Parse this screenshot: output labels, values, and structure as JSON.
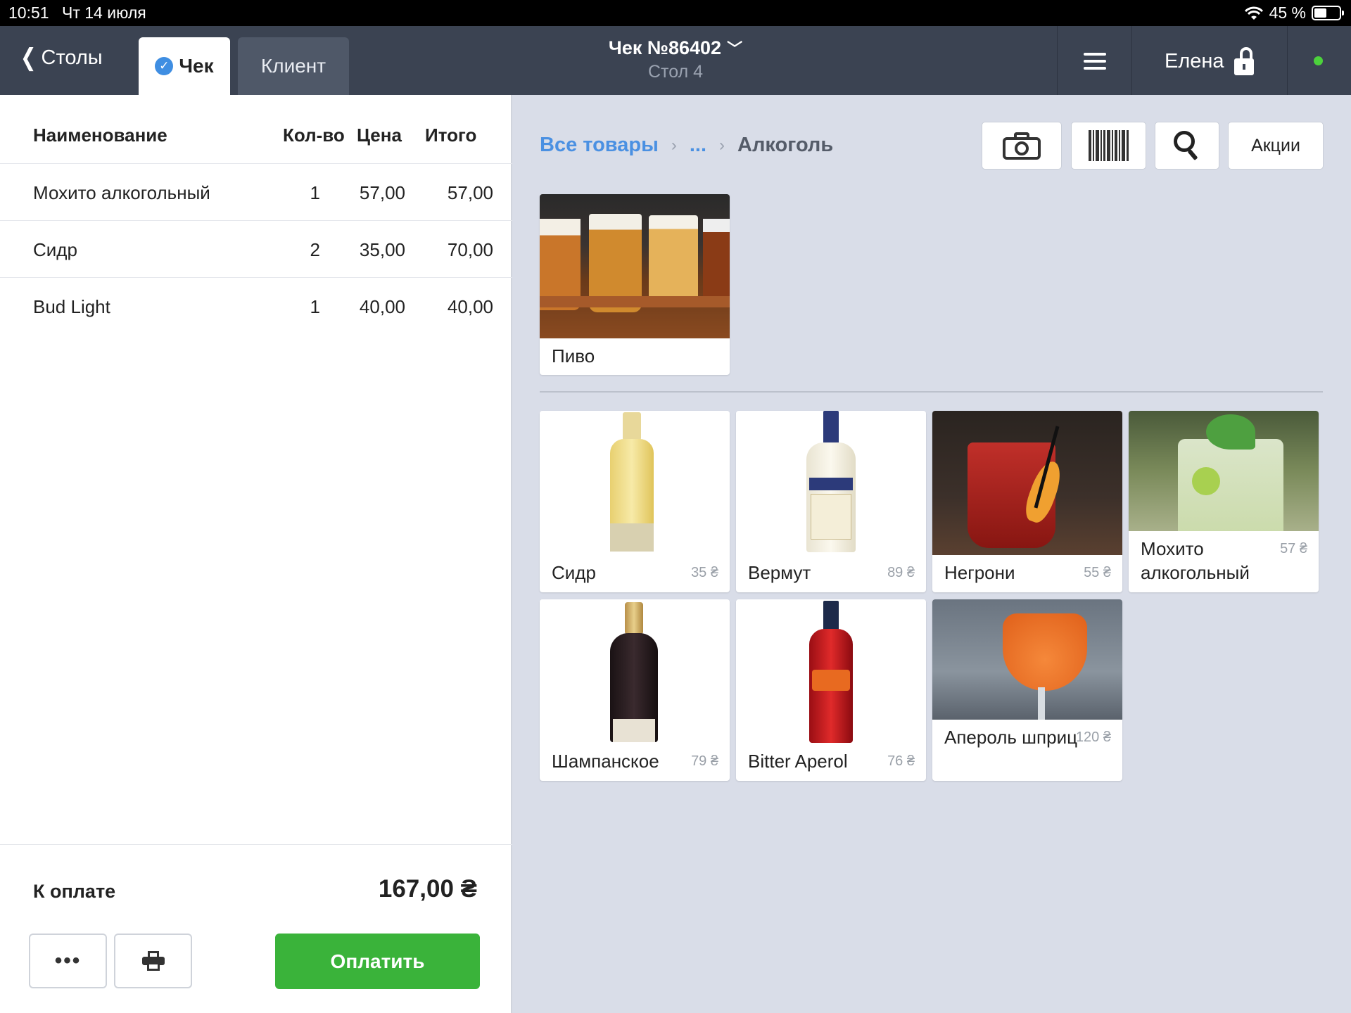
{
  "status": {
    "time": "10:51",
    "date": "Чт 14 июля",
    "battery": "45 %"
  },
  "header": {
    "back_label": "Столы",
    "tabs": [
      {
        "label": "Чек"
      },
      {
        "label": "Клиент"
      }
    ],
    "title": "Чек №86402",
    "subtitle": "Стол 4",
    "user": "Елена"
  },
  "check": {
    "columns": {
      "name": "Наименование",
      "qty": "Кол-во",
      "price": "Цена",
      "total": "Итого"
    },
    "rows": [
      {
        "name": "Мохито алкогольный",
        "qty": "1",
        "price": "57,00",
        "total": "57,00"
      },
      {
        "name": "Сидр",
        "qty": "2",
        "price": "35,00",
        "total": "70,00"
      },
      {
        "name": "Bud Light",
        "qty": "1",
        "price": "40,00",
        "total": "40,00"
      }
    ],
    "pay_label": "К оплате",
    "pay_total": "167,00 ₴",
    "more_label": "•••",
    "pay_button": "Оплатить"
  },
  "catalog": {
    "breadcrumb": {
      "root": "Все товары",
      "ellipsis": "...",
      "current": "Алкоголь"
    },
    "promo_button": "Акции",
    "category": {
      "name": "Пиво"
    },
    "products": [
      {
        "name": "Сидр",
        "price": "35 ₴"
      },
      {
        "name": "Вермут",
        "price": "89 ₴"
      },
      {
        "name": "Негрони",
        "price": "55 ₴"
      },
      {
        "name": "Мохито алкогольный",
        "price": "57 ₴"
      },
      {
        "name": "Шампанское",
        "price": "79 ₴"
      },
      {
        "name": "Bitter Aperol",
        "price": "76 ₴"
      },
      {
        "name": "Апероль шприц",
        "price": "120 ₴"
      }
    ]
  },
  "colors": {
    "header_bg": "#3b4352",
    "accent_blue": "#4a90e2",
    "pay_green": "#3ab33a",
    "online": "#4cd23c"
  }
}
